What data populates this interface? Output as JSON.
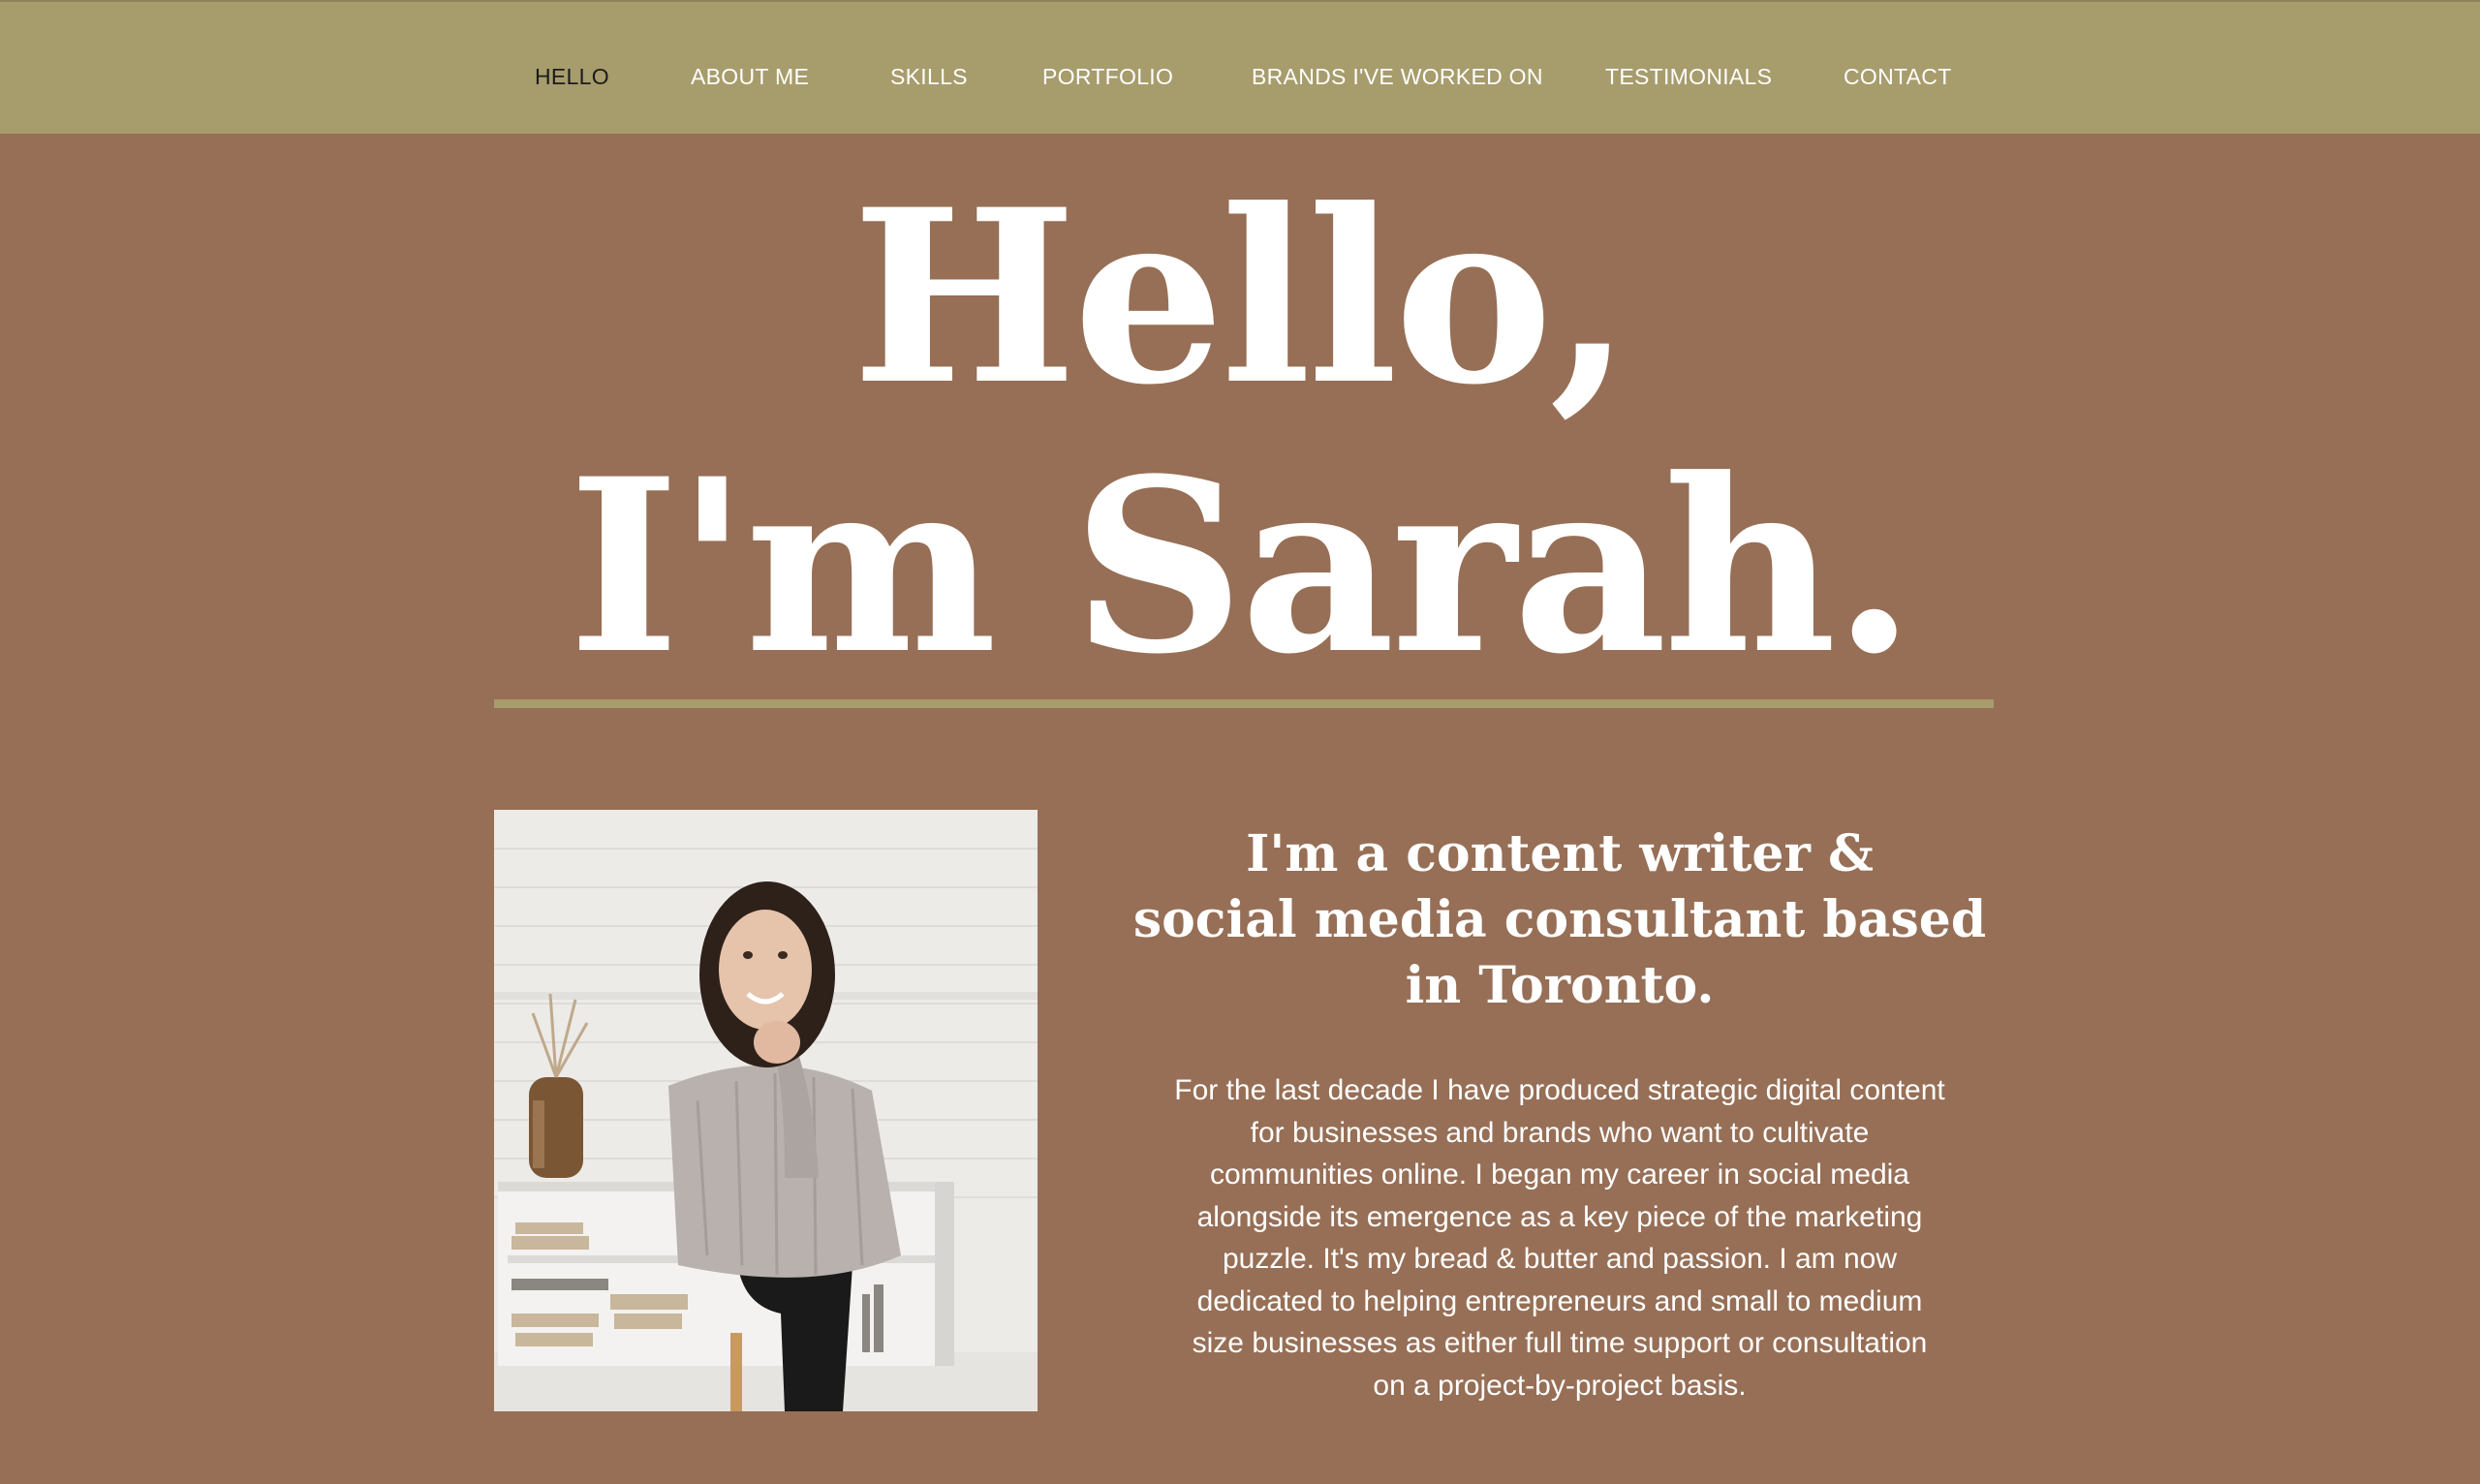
{
  "nav": {
    "items": [
      {
        "label": "HELLO",
        "active": true
      },
      {
        "label": "ABOUT ME",
        "active": false
      },
      {
        "label": "SKILLS",
        "active": false
      },
      {
        "label": "PORTFOLIO",
        "active": false
      },
      {
        "label": "BRANDS I'VE WORKED ON",
        "active": false
      },
      {
        "label": "TESTIMONIALS",
        "active": false
      },
      {
        "label": "CONTACT",
        "active": false
      }
    ]
  },
  "hero": {
    "line1": "Hello,",
    "line2": "I'm Sarah."
  },
  "about": {
    "photo_icon": "portrait-photo",
    "tagline_lines": [
      "I'm a content writer &",
      "social media consultant based",
      "in Toronto."
    ],
    "bio": "For the last decade I have produced strategic digital content for businesses and brands who want to cultivate communities online. I began my career in social media alongside its emergence as a key piece of the marketing puzzle. It's my bread & butter and passion. I am now dedicated to helping entrepreneurs and small to medium size businesses as either full time support or consultation on a project-by-project basis."
  },
  "colors": {
    "background": "#966f56",
    "nav_bar": "#a79c6c",
    "divider": "#a79c6c",
    "text": "#ffffff",
    "nav_active": "#1b1b1b"
  }
}
